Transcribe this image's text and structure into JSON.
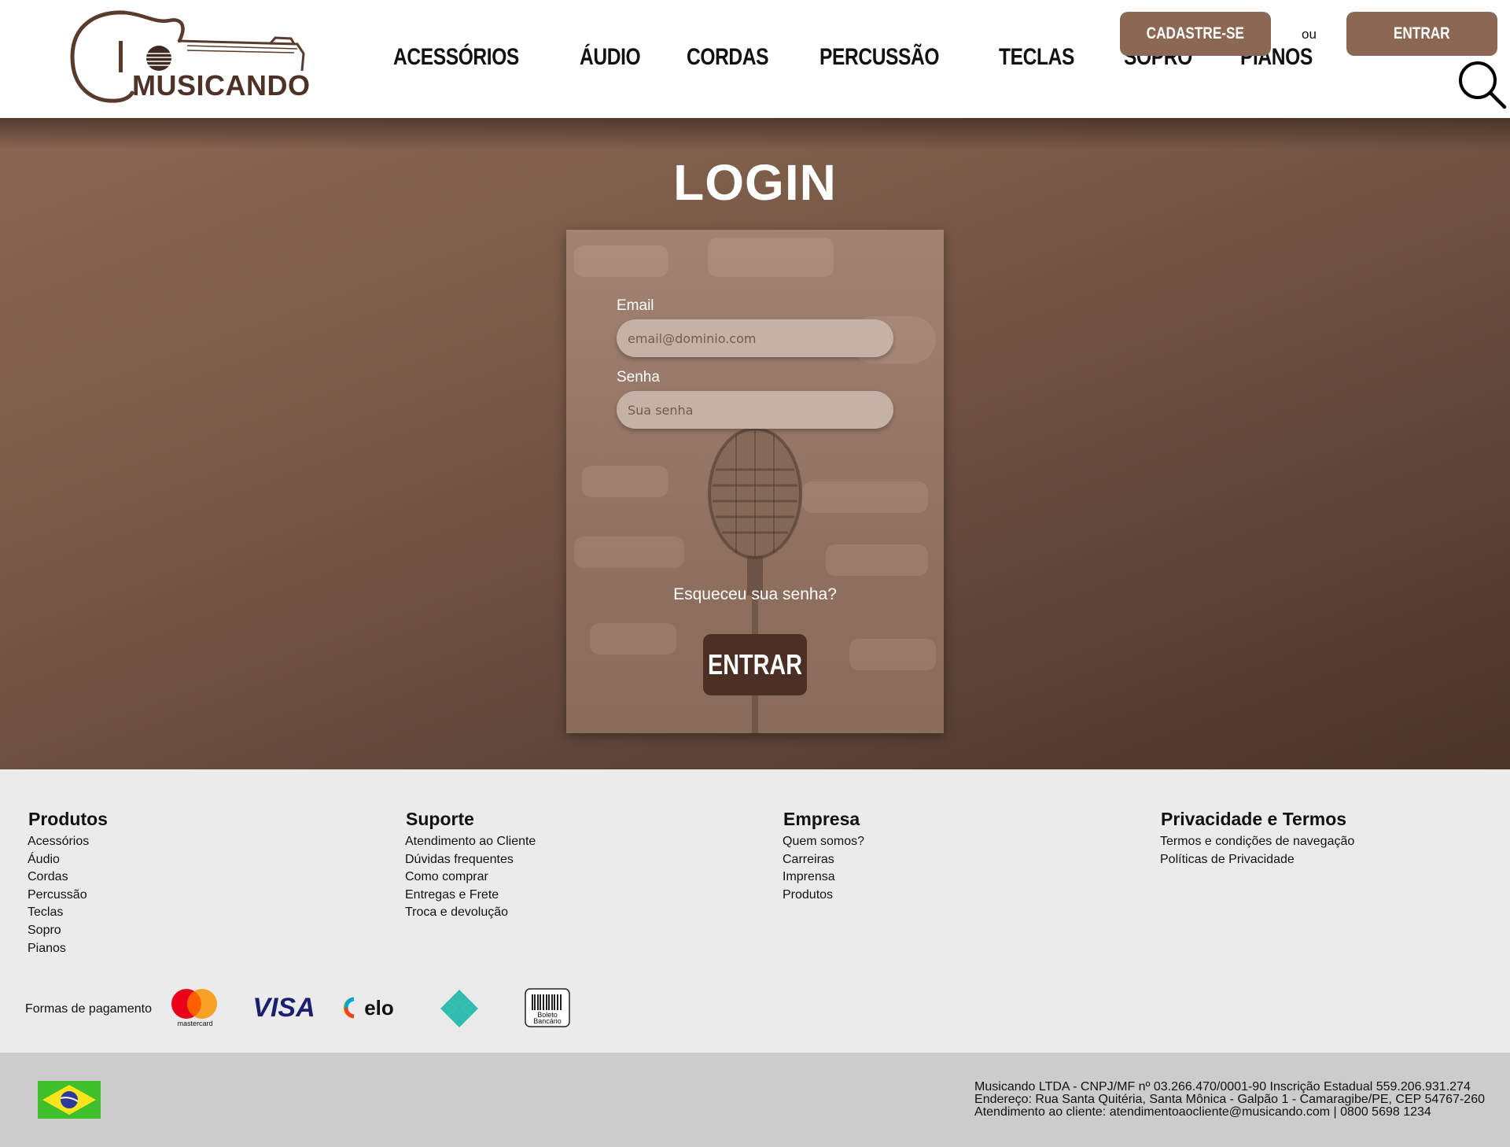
{
  "header": {
    "logo_text": "MUSICANDO",
    "nav": [
      "ACESSÓRIOS",
      "ÁUDIO",
      "CORDAS",
      "PERCUSSÃO",
      "TECLAS",
      "SOPRO",
      "PIANOS"
    ],
    "signup_label": "CADASTRE-SE",
    "or_label": "ou",
    "login_label": "ENTRAR"
  },
  "login": {
    "title": "LOGIN",
    "email_label": "Email",
    "email_placeholder": "email@dominio.com",
    "password_label": "Senha",
    "password_placeholder": "Sua senha",
    "forgot_label": "Esqueceu sua senha?",
    "submit_label": "ENTRAR"
  },
  "footer": {
    "columns": [
      {
        "title": "Produtos",
        "links": [
          "Acessórios",
          "Áudio",
          "Cordas",
          "Percussão",
          "Teclas",
          "Sopro",
          "Pianos"
        ]
      },
      {
        "title": "Suporte",
        "links": [
          "Atendimento ao Cliente",
          "Dúvidas frequentes",
          "Como comprar",
          "Entregas e Frete",
          "Troca e devolução"
        ]
      },
      {
        "title": "Empresa",
        "links": [
          "Quem somos?",
          "Carreiras",
          "Imprensa",
          "Produtos"
        ]
      },
      {
        "title": "Privacidade e Termos",
        "links": [
          "Termos e condições de navegação",
          "Políticas de Privacidade"
        ]
      }
    ],
    "payment_label": "Formas de pagamento",
    "payment_icons": [
      "mastercard-icon",
      "visa-icon",
      "elo-icon",
      "pix-icon",
      "boleto-icon"
    ],
    "mastercard_text": "mastercard",
    "visa_text": "VISA",
    "elo_text": "elo",
    "boleto_text": [
      "Boleto",
      "Bancário"
    ]
  },
  "legal": {
    "line1": "Musicando LTDA - CNPJ/MF nº 03.266.470/0001-90 Inscrição Estadual 559.206.931.274",
    "line2": "Endereço: Rua Santa Quitéria, Santa Mônica - Galpão 1 - Camaragibe/PE, CEP 54767-260",
    "line3": "Atendimento ao cliente: atendimentoaocliente@musicando.com | 0800 5698 1234"
  },
  "colors": {
    "brand_brown": "#8c6753",
    "dark_brown": "#4b2f24",
    "footer_bg": "#ebebeb",
    "bottom_bg": "#cccccc"
  }
}
